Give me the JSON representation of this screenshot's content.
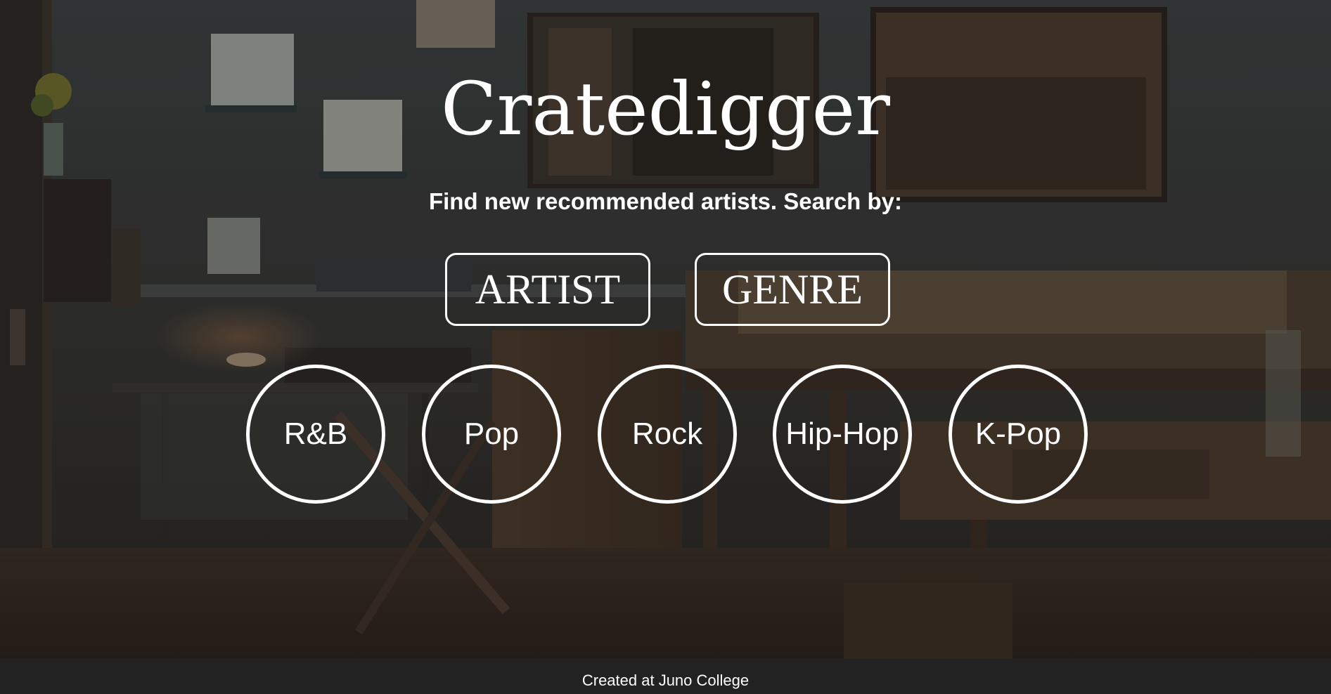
{
  "hero": {
    "title": "Cratedigger",
    "subtitle": "Find new recommended artists. Search by:"
  },
  "search_modes": [
    {
      "label": "ARTIST"
    },
    {
      "label": "GENRE"
    }
  ],
  "genres": [
    {
      "label": "R&B"
    },
    {
      "label": "Pop"
    },
    {
      "label": "Rock"
    },
    {
      "label": "Hip-Hop"
    },
    {
      "label": "K-Pop"
    }
  ],
  "footer": {
    "text": "Created at Juno College"
  },
  "colors": {
    "text": "#ffffff",
    "footer_bg": "#222222",
    "scene_tone": "#3a322c"
  }
}
